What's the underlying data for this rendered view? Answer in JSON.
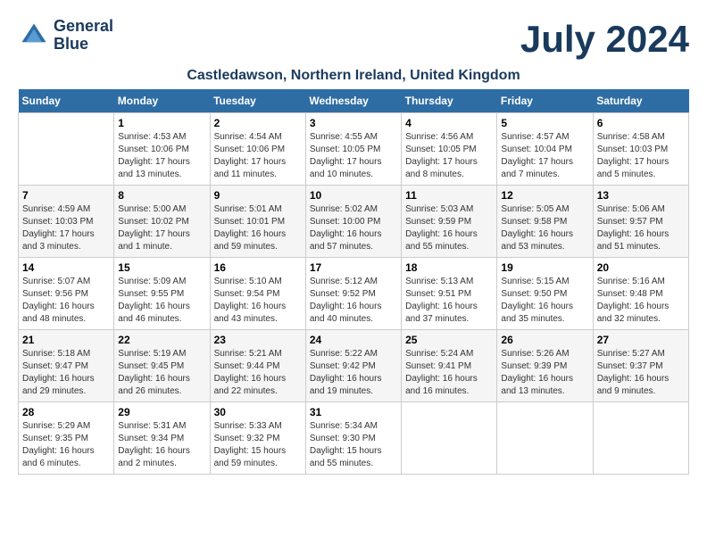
{
  "header": {
    "logo_line1": "General",
    "logo_line2": "Blue",
    "month_title": "July 2024",
    "location": "Castledawson, Northern Ireland, United Kingdom"
  },
  "weekdays": [
    "Sunday",
    "Monday",
    "Tuesday",
    "Wednesday",
    "Thursday",
    "Friday",
    "Saturday"
  ],
  "weeks": [
    [
      {
        "day": "",
        "info": ""
      },
      {
        "day": "1",
        "info": "Sunrise: 4:53 AM\nSunset: 10:06 PM\nDaylight: 17 hours\nand 13 minutes."
      },
      {
        "day": "2",
        "info": "Sunrise: 4:54 AM\nSunset: 10:06 PM\nDaylight: 17 hours\nand 11 minutes."
      },
      {
        "day": "3",
        "info": "Sunrise: 4:55 AM\nSunset: 10:05 PM\nDaylight: 17 hours\nand 10 minutes."
      },
      {
        "day": "4",
        "info": "Sunrise: 4:56 AM\nSunset: 10:05 PM\nDaylight: 17 hours\nand 8 minutes."
      },
      {
        "day": "5",
        "info": "Sunrise: 4:57 AM\nSunset: 10:04 PM\nDaylight: 17 hours\nand 7 minutes."
      },
      {
        "day": "6",
        "info": "Sunrise: 4:58 AM\nSunset: 10:03 PM\nDaylight: 17 hours\nand 5 minutes."
      }
    ],
    [
      {
        "day": "7",
        "info": "Sunrise: 4:59 AM\nSunset: 10:03 PM\nDaylight: 17 hours\nand 3 minutes."
      },
      {
        "day": "8",
        "info": "Sunrise: 5:00 AM\nSunset: 10:02 PM\nDaylight: 17 hours\nand 1 minute."
      },
      {
        "day": "9",
        "info": "Sunrise: 5:01 AM\nSunset: 10:01 PM\nDaylight: 16 hours\nand 59 minutes."
      },
      {
        "day": "10",
        "info": "Sunrise: 5:02 AM\nSunset: 10:00 PM\nDaylight: 16 hours\nand 57 minutes."
      },
      {
        "day": "11",
        "info": "Sunrise: 5:03 AM\nSunset: 9:59 PM\nDaylight: 16 hours\nand 55 minutes."
      },
      {
        "day": "12",
        "info": "Sunrise: 5:05 AM\nSunset: 9:58 PM\nDaylight: 16 hours\nand 53 minutes."
      },
      {
        "day": "13",
        "info": "Sunrise: 5:06 AM\nSunset: 9:57 PM\nDaylight: 16 hours\nand 51 minutes."
      }
    ],
    [
      {
        "day": "14",
        "info": "Sunrise: 5:07 AM\nSunset: 9:56 PM\nDaylight: 16 hours\nand 48 minutes."
      },
      {
        "day": "15",
        "info": "Sunrise: 5:09 AM\nSunset: 9:55 PM\nDaylight: 16 hours\nand 46 minutes."
      },
      {
        "day": "16",
        "info": "Sunrise: 5:10 AM\nSunset: 9:54 PM\nDaylight: 16 hours\nand 43 minutes."
      },
      {
        "day": "17",
        "info": "Sunrise: 5:12 AM\nSunset: 9:52 PM\nDaylight: 16 hours\nand 40 minutes."
      },
      {
        "day": "18",
        "info": "Sunrise: 5:13 AM\nSunset: 9:51 PM\nDaylight: 16 hours\nand 37 minutes."
      },
      {
        "day": "19",
        "info": "Sunrise: 5:15 AM\nSunset: 9:50 PM\nDaylight: 16 hours\nand 35 minutes."
      },
      {
        "day": "20",
        "info": "Sunrise: 5:16 AM\nSunset: 9:48 PM\nDaylight: 16 hours\nand 32 minutes."
      }
    ],
    [
      {
        "day": "21",
        "info": "Sunrise: 5:18 AM\nSunset: 9:47 PM\nDaylight: 16 hours\nand 29 minutes."
      },
      {
        "day": "22",
        "info": "Sunrise: 5:19 AM\nSunset: 9:45 PM\nDaylight: 16 hours\nand 26 minutes."
      },
      {
        "day": "23",
        "info": "Sunrise: 5:21 AM\nSunset: 9:44 PM\nDaylight: 16 hours\nand 22 minutes."
      },
      {
        "day": "24",
        "info": "Sunrise: 5:22 AM\nSunset: 9:42 PM\nDaylight: 16 hours\nand 19 minutes."
      },
      {
        "day": "25",
        "info": "Sunrise: 5:24 AM\nSunset: 9:41 PM\nDaylight: 16 hours\nand 16 minutes."
      },
      {
        "day": "26",
        "info": "Sunrise: 5:26 AM\nSunset: 9:39 PM\nDaylight: 16 hours\nand 13 minutes."
      },
      {
        "day": "27",
        "info": "Sunrise: 5:27 AM\nSunset: 9:37 PM\nDaylight: 16 hours\nand 9 minutes."
      }
    ],
    [
      {
        "day": "28",
        "info": "Sunrise: 5:29 AM\nSunset: 9:35 PM\nDaylight: 16 hours\nand 6 minutes."
      },
      {
        "day": "29",
        "info": "Sunrise: 5:31 AM\nSunset: 9:34 PM\nDaylight: 16 hours\nand 2 minutes."
      },
      {
        "day": "30",
        "info": "Sunrise: 5:33 AM\nSunset: 9:32 PM\nDaylight: 15 hours\nand 59 minutes."
      },
      {
        "day": "31",
        "info": "Sunrise: 5:34 AM\nSunset: 9:30 PM\nDaylight: 15 hours\nand 55 minutes."
      },
      {
        "day": "",
        "info": ""
      },
      {
        "day": "",
        "info": ""
      },
      {
        "day": "",
        "info": ""
      }
    ]
  ]
}
